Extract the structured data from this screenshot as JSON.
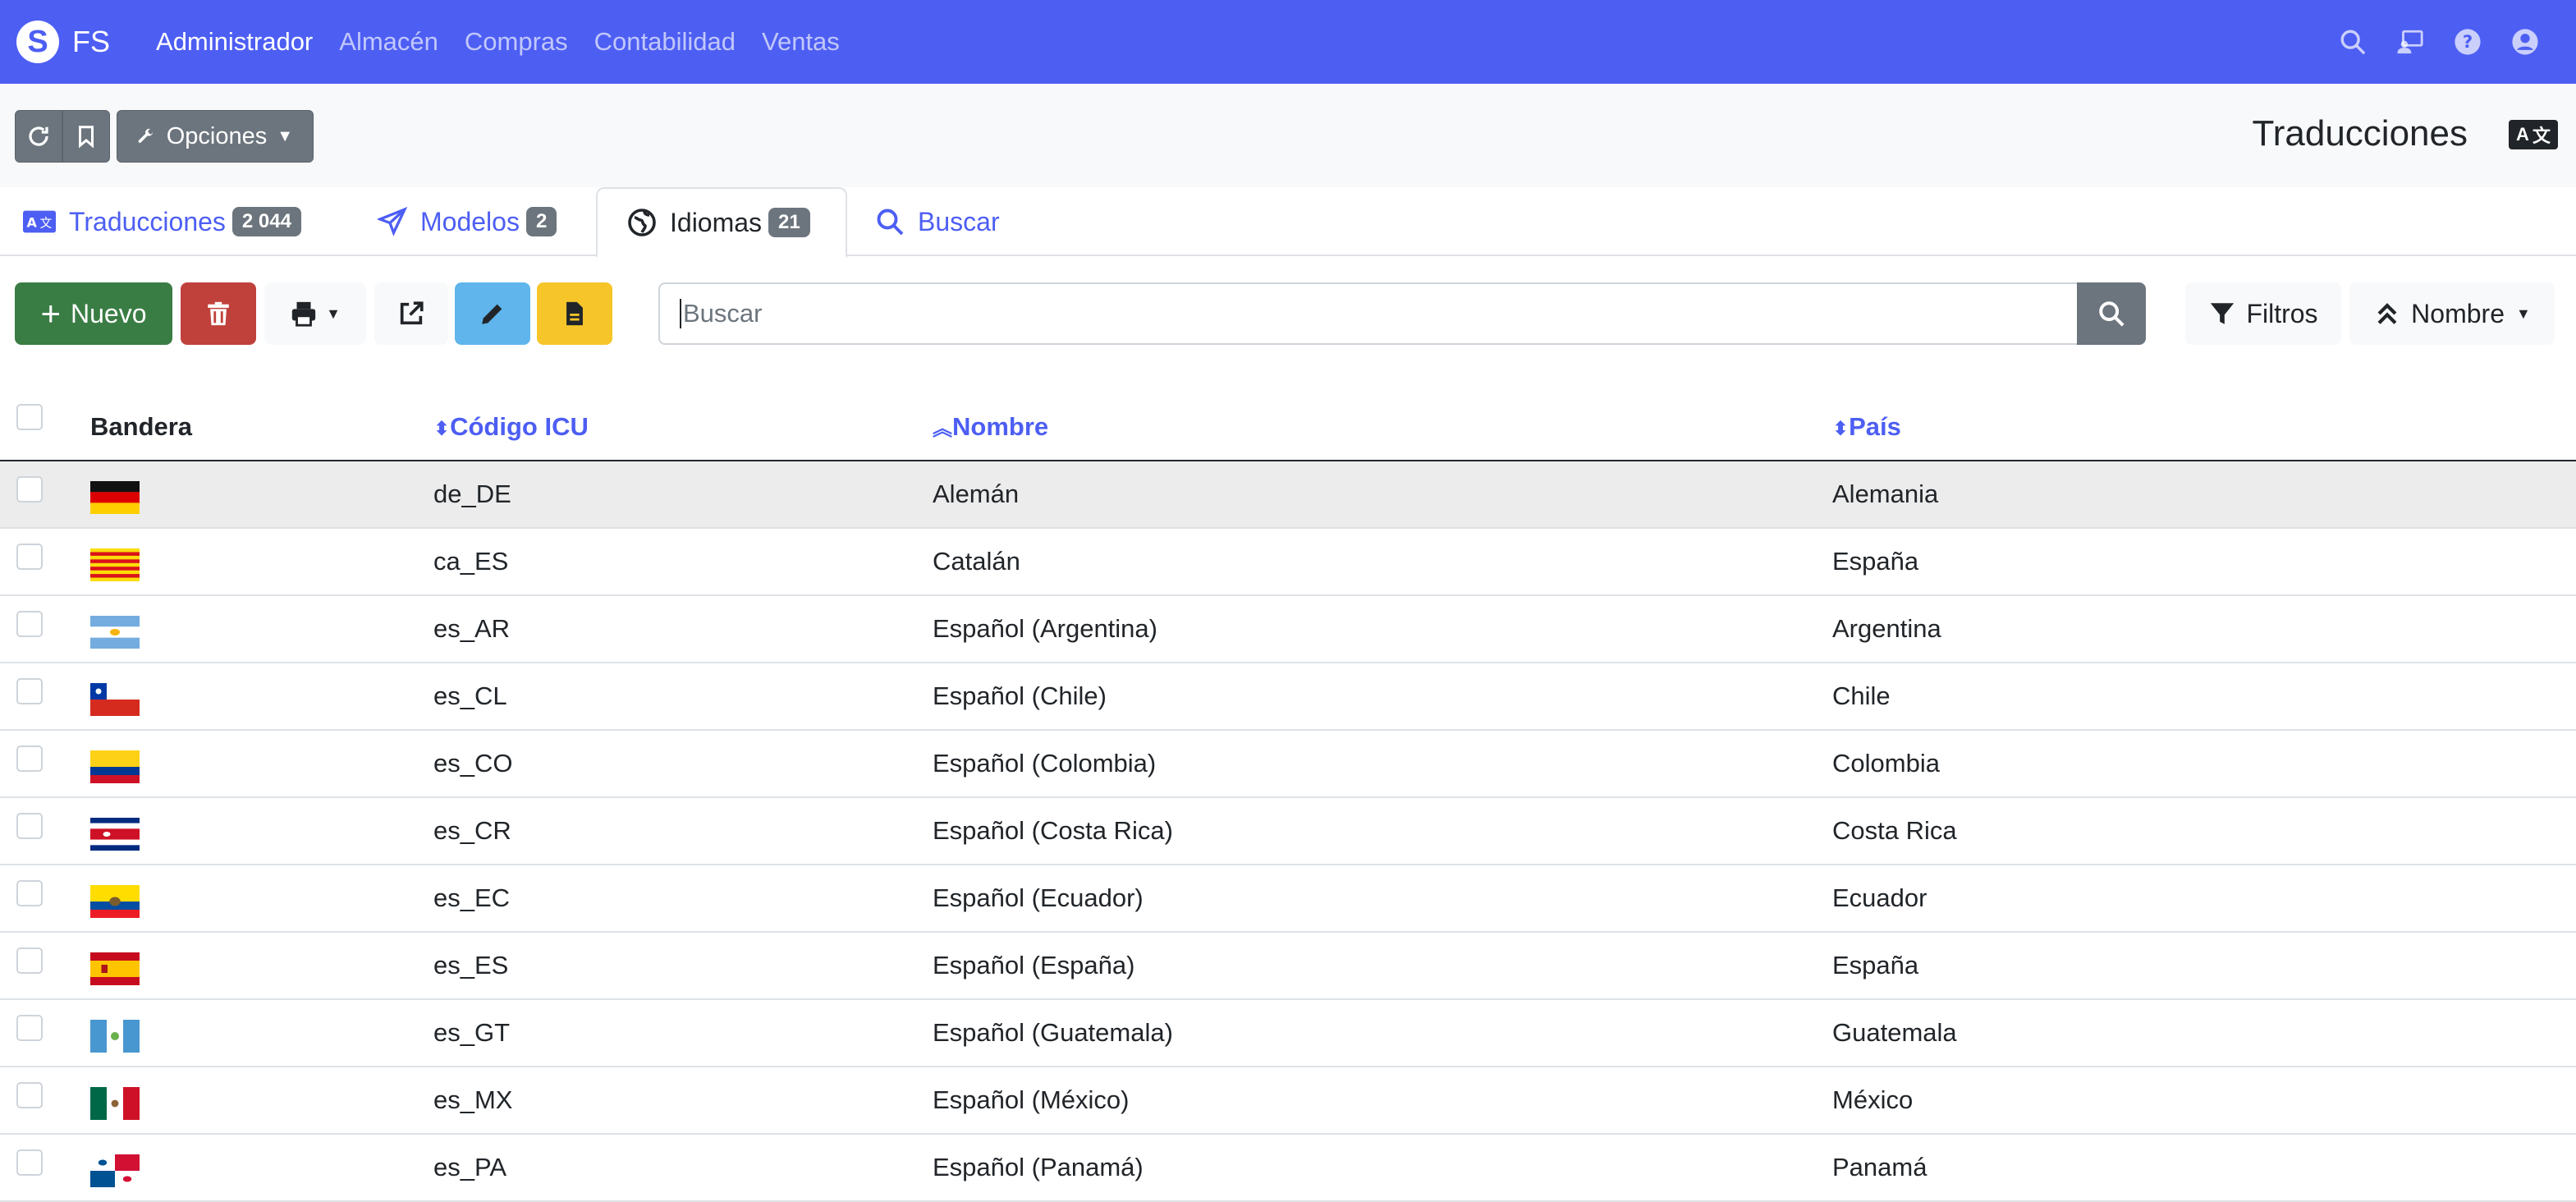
{
  "navbar": {
    "brand": "FS",
    "items": [
      {
        "label": "Administrador",
        "active": true
      },
      {
        "label": "Almacén",
        "active": false
      },
      {
        "label": "Compras",
        "active": false
      },
      {
        "label": "Contabilidad",
        "active": false
      },
      {
        "label": "Ventas",
        "active": false
      }
    ],
    "icons": [
      "search-icon",
      "user-tie-icon",
      "question-icon",
      "user-circle-icon"
    ]
  },
  "toolbar": {
    "options_label": "Opciones"
  },
  "page": {
    "title": "Traducciones"
  },
  "tabs": [
    {
      "label": "Traducciones",
      "badge": "2 044",
      "icon": "language-icon"
    },
    {
      "label": "Modelos",
      "badge": "2",
      "icon": "paper-plane-icon"
    },
    {
      "label": "Idiomas",
      "badge": "21",
      "icon": "globe-icon",
      "active": true
    },
    {
      "label": "Buscar",
      "badge": "",
      "icon": "search-icon"
    }
  ],
  "actions": {
    "new_label": "Nuevo",
    "search_placeholder": "Buscar",
    "filters_label": "Filtros",
    "sort_label": "Nombre"
  },
  "table": {
    "headers": {
      "flag": "Bandera",
      "code": "Código ICU",
      "name": "Nombre",
      "country": "País"
    },
    "rows": [
      {
        "code": "de_DE",
        "name": "Alemán",
        "country": "Alemania"
      },
      {
        "code": "ca_ES",
        "name": "Catalán",
        "country": "España"
      },
      {
        "code": "es_AR",
        "name": "Español (Argentina)",
        "country": "Argentina"
      },
      {
        "code": "es_CL",
        "name": "Español (Chile)",
        "country": "Chile"
      },
      {
        "code": "es_CO",
        "name": "Español (Colombia)",
        "country": "Colombia"
      },
      {
        "code": "es_CR",
        "name": "Español (Costa Rica)",
        "country": "Costa Rica"
      },
      {
        "code": "es_EC",
        "name": "Español (Ecuador)",
        "country": "Ecuador"
      },
      {
        "code": "es_ES",
        "name": "Español (España)",
        "country": "España"
      },
      {
        "code": "es_GT",
        "name": "Español (Guatemala)",
        "country": "Guatemala"
      },
      {
        "code": "es_MX",
        "name": "Español (México)",
        "country": "México"
      },
      {
        "code": "es_PA",
        "name": "Español (Panamá)",
        "country": "Panamá"
      }
    ]
  },
  "colors": {
    "primary": "#4d5ef3",
    "success": "#3a7d44",
    "danger": "#c0413b",
    "info": "#5fb5ec",
    "warning": "#f5c52a",
    "secondary": "#6c757d"
  }
}
